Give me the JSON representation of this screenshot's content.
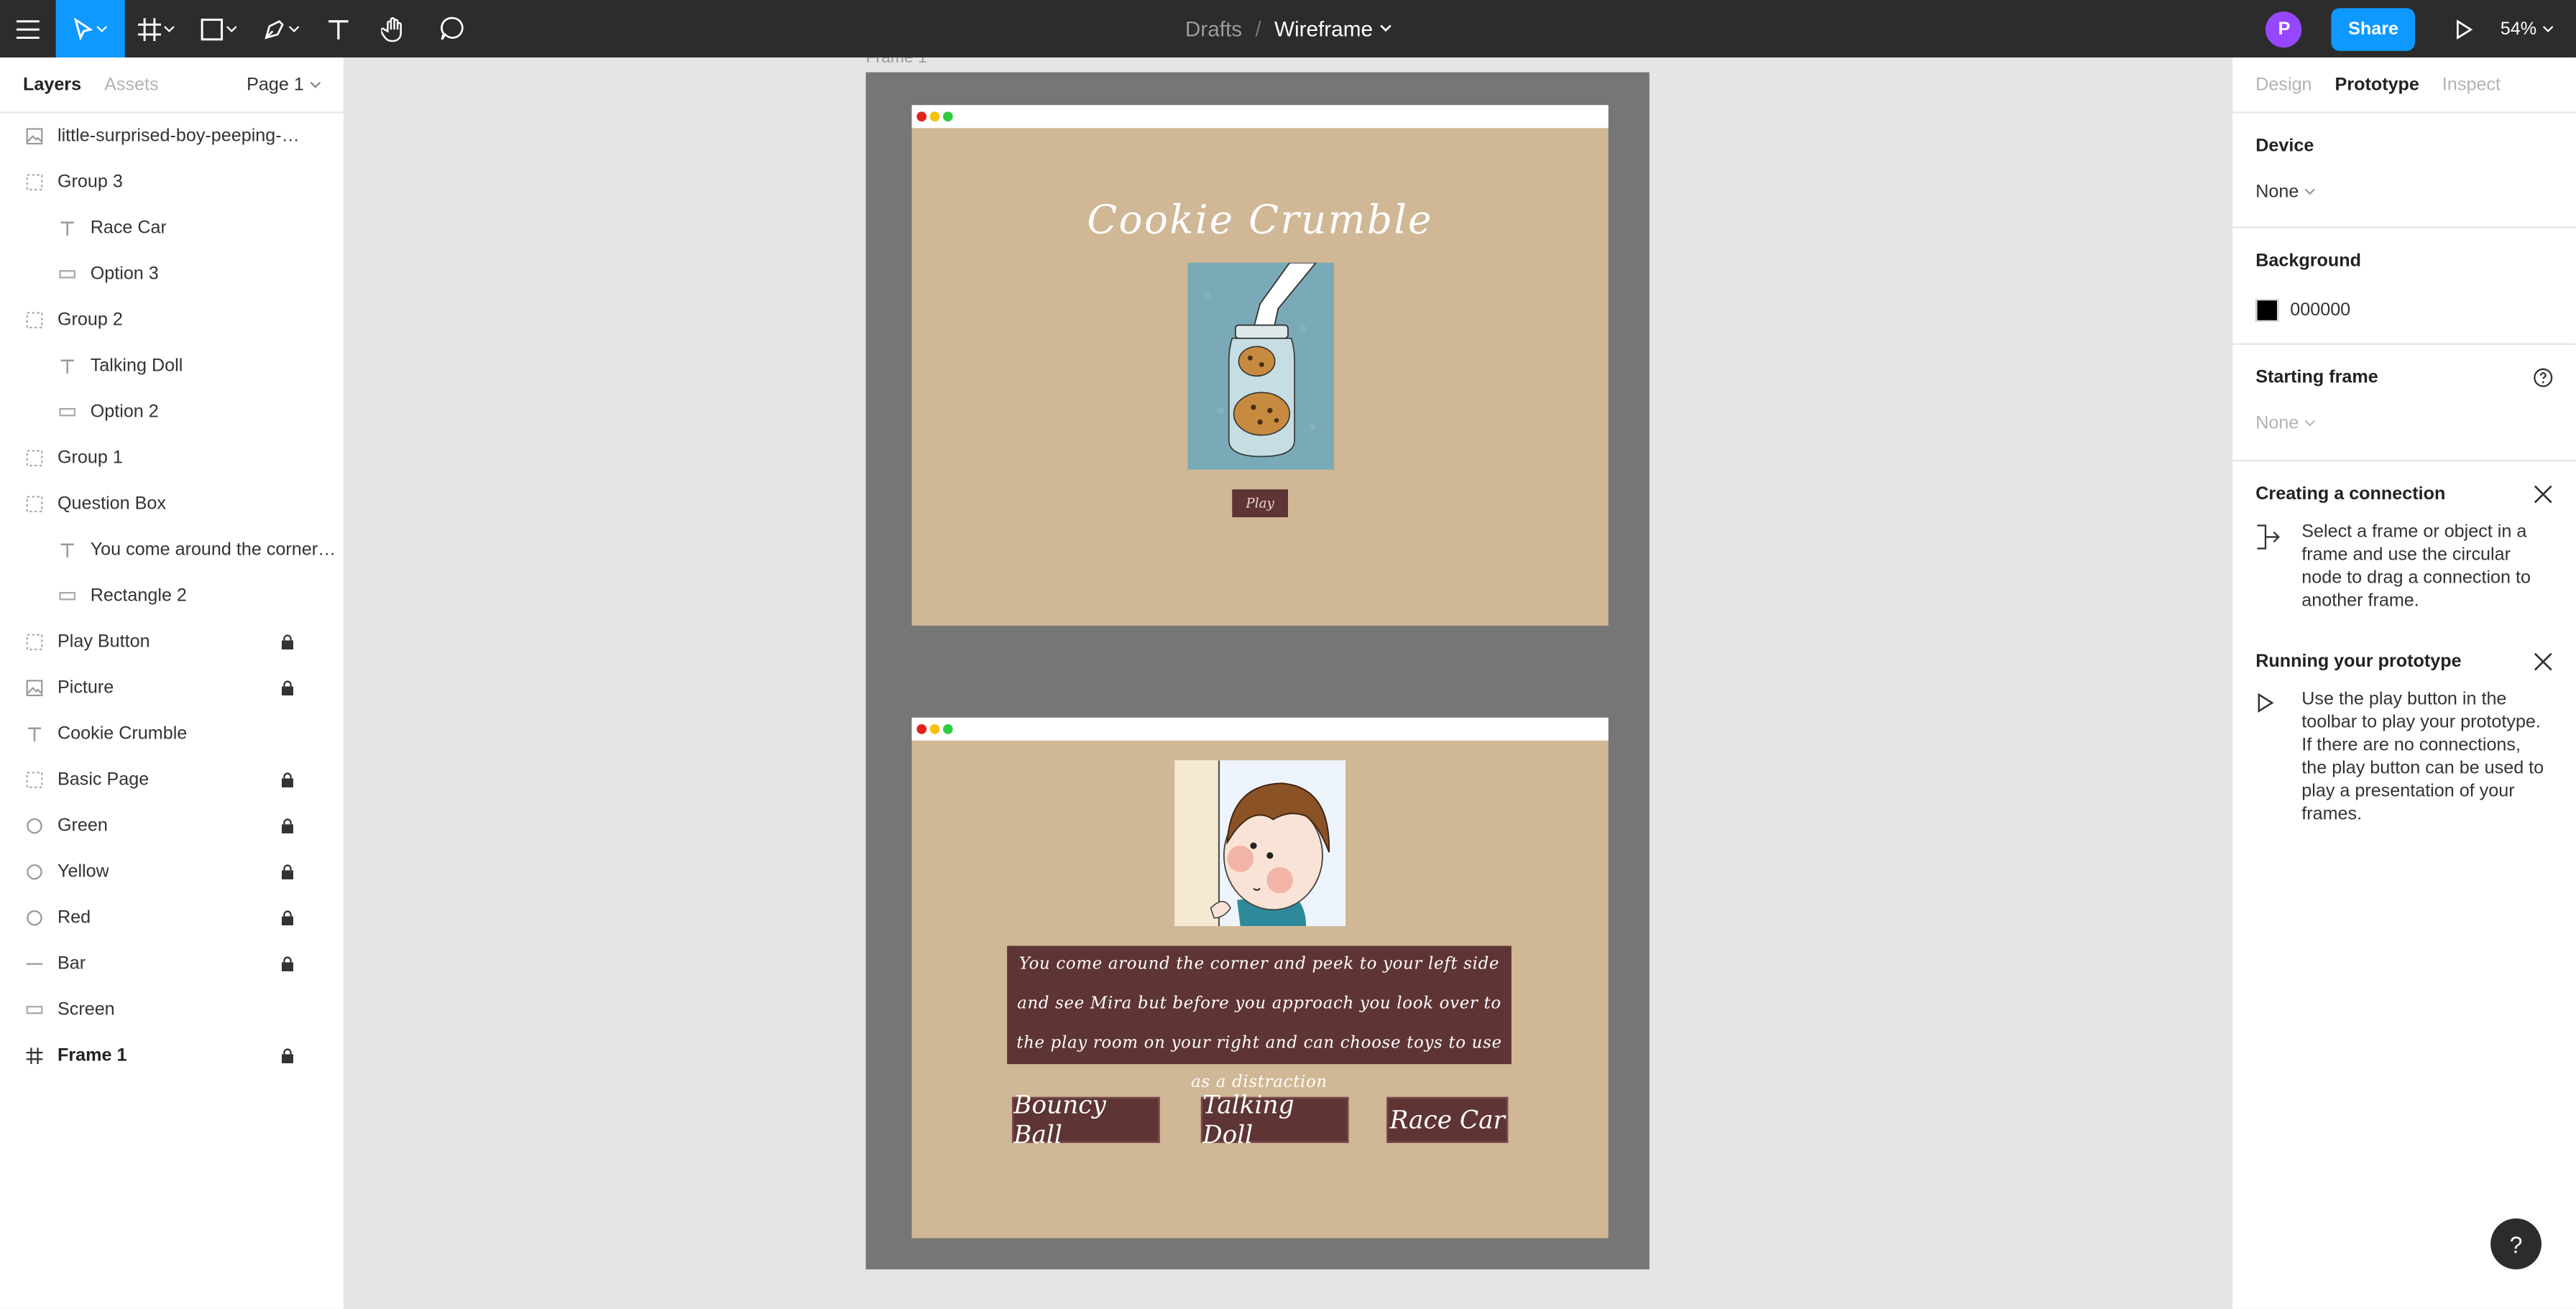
{
  "toolbar": {
    "breadcrumb_team": "Drafts",
    "breadcrumb_sep": "/",
    "file_name": "Wireframe",
    "avatar_initial": "P",
    "share_label": "Share",
    "zoom_label": "54%",
    "accent_color": "#0d99ff",
    "avatar_color": "#9747ff"
  },
  "left_panel": {
    "tab_layers": "Layers",
    "tab_assets": "Assets",
    "page_selector": "Page 1",
    "layers": [
      {
        "name": "little-surprised-boy-peeping-out-...",
        "icon": "image-icon",
        "child": false,
        "locked": false
      },
      {
        "name": "Group 3",
        "icon": "group-icon",
        "child": false,
        "locked": false
      },
      {
        "name": "Race Car",
        "icon": "text-icon",
        "child": true,
        "locked": false
      },
      {
        "name": "Option 3",
        "icon": "rectangle-icon",
        "child": true,
        "locked": false
      },
      {
        "name": "Group 2",
        "icon": "group-icon",
        "child": false,
        "locked": false
      },
      {
        "name": "Talking Doll",
        "icon": "text-icon",
        "child": true,
        "locked": false
      },
      {
        "name": "Option 2",
        "icon": "rectangle-icon",
        "child": true,
        "locked": false
      },
      {
        "name": "Group 1",
        "icon": "group-icon",
        "child": false,
        "locked": false
      },
      {
        "name": "Question Box",
        "icon": "group-icon",
        "child": false,
        "locked": false
      },
      {
        "name": "You come around the corner a...",
        "icon": "text-icon",
        "child": true,
        "locked": false
      },
      {
        "name": "Rectangle 2",
        "icon": "rectangle-icon",
        "child": true,
        "locked": false
      },
      {
        "name": "Play Button",
        "icon": "group-icon",
        "child": false,
        "locked": true
      },
      {
        "name": "Picture",
        "icon": "image-icon",
        "child": false,
        "locked": true
      },
      {
        "name": "Cookie Crumble",
        "icon": "text-icon",
        "child": false,
        "locked": false
      },
      {
        "name": "Basic Page",
        "icon": "group-icon",
        "child": false,
        "locked": true
      },
      {
        "name": "Green",
        "icon": "ellipse-icon",
        "child": false,
        "locked": true
      },
      {
        "name": "Yellow",
        "icon": "ellipse-icon",
        "child": false,
        "locked": true
      },
      {
        "name": "Red",
        "icon": "ellipse-icon",
        "child": false,
        "locked": true
      },
      {
        "name": "Bar",
        "icon": "line-icon",
        "child": false,
        "locked": true
      },
      {
        "name": "Screen",
        "icon": "rectangle-icon",
        "child": false,
        "locked": false
      },
      {
        "name": "Frame 1",
        "icon": "frame-icon",
        "child": false,
        "locked": true,
        "bold": true
      }
    ]
  },
  "canvas": {
    "frame_label": "Frame 1",
    "screen1": {
      "title": "Cookie Crumble",
      "play_label": "Play"
    },
    "screen2": {
      "question": "You come around the corner and peek to your left side and see Mira but before you approach you look over to the play room on your right and can choose toys to use as a distraction",
      "options": [
        "Bouncy Ball",
        "Talking Doll",
        "Race Car"
      ]
    },
    "colors": {
      "frame_bg": "#767676",
      "screen_bg": "#d0b795",
      "button_bg": "#5f3434"
    }
  },
  "right_panel": {
    "tab_design": "Design",
    "tab_prototype": "Prototype",
    "tab_inspect": "Inspect",
    "device_title": "Device",
    "device_value": "None",
    "background_title": "Background",
    "background_hex": "000000",
    "starting_frame_title": "Starting frame",
    "starting_frame_value": "None",
    "connection_title": "Creating a connection",
    "connection_text": "Select a frame or object in a frame and use the circular node to drag a connection to another frame.",
    "running_title": "Running your prototype",
    "running_text": "Use the play button in the toolbar to play your prototype. If there are no connections, the play button can be used to play a presentation of your frames."
  },
  "help_button_label": "?"
}
